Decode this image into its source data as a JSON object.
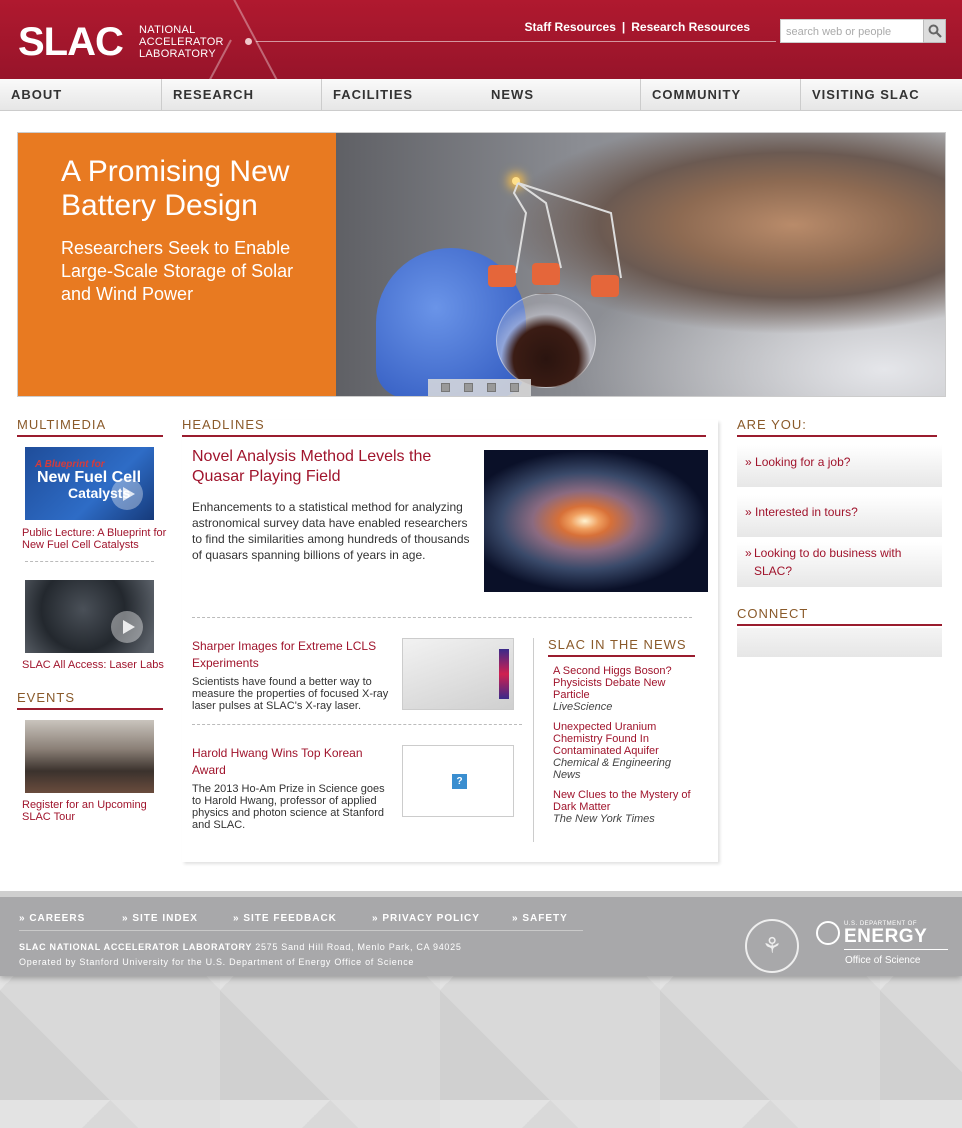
{
  "header": {
    "logo": "SLAC",
    "logo_sub": [
      "NATIONAL",
      "ACCELERATOR",
      "LABORATORY"
    ],
    "staff_resources": "Staff Resources",
    "separator": "|",
    "research_resources": "Research Resources",
    "search_placeholder": "search web or people"
  },
  "nav": {
    "items": [
      "ABOUT",
      "RESEARCH",
      "FACILITIES",
      "NEWS",
      "COMMUNITY",
      "VISITING SLAC"
    ]
  },
  "hero": {
    "title": "A Promising New Battery Design",
    "subtitle": "Researchers Seek to Enable Large-Scale Storage of Solar and Wind Power",
    "slide_count": 4
  },
  "multimedia": {
    "heading": "MULTIMEDIA",
    "items": [
      {
        "caption": "Public Lecture: A Blueprint for New Fuel Cell Catalysts",
        "thumb_line1": "A Blueprint for",
        "thumb_line2": "New Fuel Cell",
        "thumb_line3": "Catalysts"
      },
      {
        "caption": "SLAC All Access: Laser Labs"
      }
    ]
  },
  "events": {
    "heading": "EVENTS",
    "caption": "Register for an Upcoming SLAC Tour"
  },
  "headlines": {
    "heading": "HEADLINES",
    "lead": {
      "title": "Novel Analysis Method Levels the Quasar Playing Field",
      "text": "Enhancements to a statistical method for analyzing astronomical survey data have enabled researchers to find the similarities among hundreds of thousands of quasars spanning billions of years in age."
    },
    "stories": [
      {
        "title": "Sharper Images for Extreme LCLS Experiments",
        "text": "Scientists have found a better way to measure the properties of focused X-ray laser pulses at SLAC's X-ray laser."
      },
      {
        "title": "Harold Hwang Wins Top Korean Award",
        "text": "The 2013 Ho-Am Prize in Science goes to Harold Hwang, professor of applied physics and photon science at Stanford and SLAC."
      }
    ],
    "missing_image_icon": "?"
  },
  "in_the_news": {
    "heading": "SLAC IN THE NEWS",
    "items": [
      {
        "title": "A Second Higgs Boson? Physicists Debate New Particle",
        "source": "LiveScience"
      },
      {
        "title": "Unexpected Uranium Chemistry Found In Contaminated Aquifer",
        "source": "Chemical & Engineering News"
      },
      {
        "title": "New Clues to the Mystery of Dark Matter",
        "source": "The New York Times"
      }
    ]
  },
  "are_you": {
    "heading": "ARE YOU:",
    "items": [
      "Looking for a job?",
      "Interested in tours?",
      "Looking to do business with SLAC?"
    ],
    "bullet": "»"
  },
  "connect": {
    "heading": "CONNECT"
  },
  "footer": {
    "links": [
      "» CAREERS",
      "» SITE INDEX",
      "» SITE FEEDBACK",
      "» PRIVACY POLICY",
      "» SAFETY"
    ],
    "address_name": "SLAC NATIONAL ACCELERATOR LABORATORY",
    "address": "2575 Sand Hill Road, Menlo Park, CA 94025",
    "operated": "Operated by Stanford University for the U.S. Department of Energy Office of Science",
    "doe_top": "U.S. DEPARTMENT OF",
    "doe_energy": "ENERGY",
    "doe_office": "Office of Science"
  },
  "colors": {
    "brand": "#a0142c",
    "hero_orange": "#e87a21",
    "section_heading": "#8a5a2a"
  }
}
